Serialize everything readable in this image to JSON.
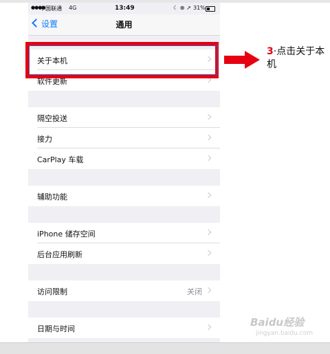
{
  "status_bar": {
    "signal": "●●●●",
    "carrier": "中国联通",
    "network": "4G",
    "time": "13:49",
    "icons": "☾ ⊕ ↗",
    "battery_percent": "31%"
  },
  "nav": {
    "back_label": "设置",
    "title": "通用"
  },
  "rows": {
    "about": "关于本机",
    "software_update": "软件更新",
    "airdrop": "隔空投送",
    "handoff": "接力",
    "carplay": "CarPlay 车载",
    "accessibility": "辅助功能",
    "storage": "iPhone 储存空间",
    "background_refresh": "后台应用刷新",
    "restrictions": "访问限制",
    "restrictions_value": "关闭",
    "date_time": "日期与时间"
  },
  "annotation": {
    "step_number": "3",
    "text": "·点击关于本机"
  },
  "watermark": {
    "brand": "Baidu经验",
    "url": "jingyan.baidu.com"
  },
  "colors": {
    "highlight": "#e60012",
    "accent": "#0a7aff",
    "background": "#efeff4"
  }
}
